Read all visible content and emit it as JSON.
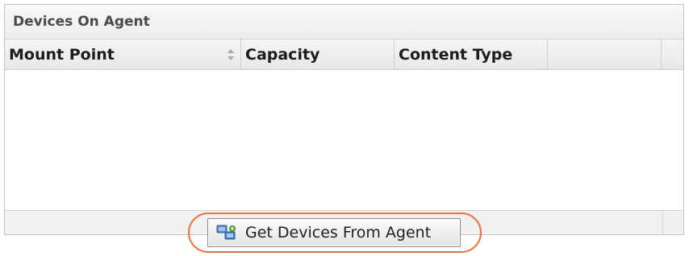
{
  "panel": {
    "title": "Devices On Agent"
  },
  "grid": {
    "columns": [
      {
        "label": "Mount Point",
        "sortable": true
      },
      {
        "label": "Capacity"
      },
      {
        "label": "Content Type"
      },
      {
        "label": ""
      }
    ],
    "rows": []
  },
  "toolbar": {
    "get_devices_label": "Get Devices From Agent",
    "get_devices_icon": "devices-sync-icon"
  },
  "colors": {
    "highlight": "#e8743b"
  }
}
